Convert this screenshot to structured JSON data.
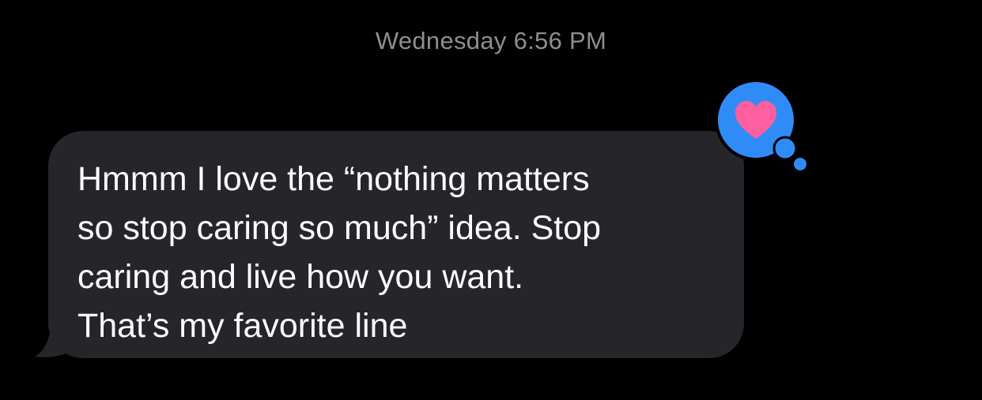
{
  "conversation": {
    "timestamp": "Wednesday 6:56 PM",
    "message": {
      "text": "Hmmm I love the “nothing matters\nso stop caring so much” idea. Stop\ncaring and live how you want.\nThat’s my favorite line"
    },
    "tapback": {
      "icon": "heart-icon",
      "bubble_color": "#2f8cf7",
      "heart_color": "#ff5f9e"
    },
    "bubble_color": "#26252a"
  }
}
